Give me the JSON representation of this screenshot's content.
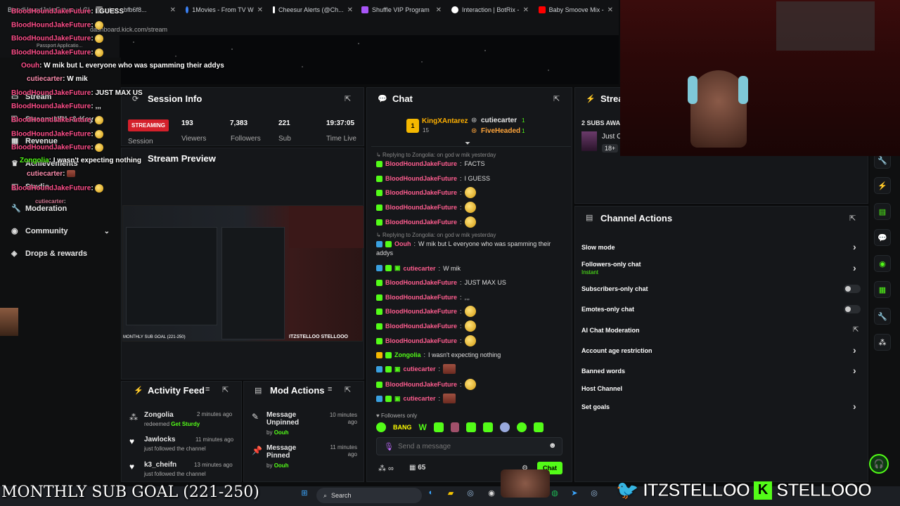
{
  "browser": {
    "tabs": [
      {
        "label": "BloodHoundJakeFuture : I GUESS",
        "icon_color": "#ff4f8b"
      },
      {
        "label": "shot - bfb6f8...",
        "icon_color": "#888888"
      },
      {
        "label": "1Movies - From TV W",
        "icon_color": "#3b82f6"
      },
      {
        "label": "Cheesur Alerts (@Ch...",
        "icon_color": "#ffffff"
      },
      {
        "label": "Shuffle VIP Program",
        "icon_color": "#a855f7"
      },
      {
        "label": "Interaction | BotRix -",
        "icon_color": "#ffffff"
      },
      {
        "label": "Baby Smoove Mix -",
        "icon_color": "#ff0000"
      }
    ],
    "url": "dashboard.kick.com/stream",
    "passport": "Passport Applicatio..."
  },
  "sidebar": {
    "items": [
      {
        "label": "Stream",
        "icon": "stream-icon"
      },
      {
        "label": "Stream URL & Key",
        "icon": "key-icon"
      },
      {
        "label": "Revenue",
        "icon": "revenue-icon"
      },
      {
        "label": "Achievements",
        "icon": "trophy-icon"
      },
      {
        "label": "Studio",
        "icon": "studio-icon"
      },
      {
        "label": "Moderation",
        "icon": "wrench-icon"
      },
      {
        "label": "Community",
        "icon": "community-icon"
      },
      {
        "label": "Drops & rewards",
        "icon": "drops-icon"
      }
    ]
  },
  "session_info": {
    "title": "Session Info",
    "status": "STREAMING",
    "status_label": "Session",
    "stats": [
      {
        "value": "193",
        "label": "Viewers"
      },
      {
        "value": "7,383",
        "label": "Followers"
      },
      {
        "value": "221",
        "label": "Sub"
      },
      {
        "value": "19:37:05",
        "label": "Time Live"
      }
    ]
  },
  "stream_preview": {
    "title": "Stream Preview",
    "goal_text": "MONTHLY SUB GOAL (221-250)",
    "handles": "ITZSTELLOO  STELLOOO"
  },
  "activity_feed": {
    "title": "Activity Feed",
    "items": [
      {
        "user": "Zongolia",
        "action": "redeemed",
        "reward": "Get Sturdy",
        "time": "2 minutes ago",
        "icon": "redeem-icon"
      },
      {
        "user": "Jawlocks",
        "action": "just followed the channel",
        "time": "11 minutes ago",
        "icon": "heart-icon"
      },
      {
        "user": "k3_cheifn",
        "action": "just followed the channel",
        "time": "13 minutes ago",
        "icon": "heart-icon"
      }
    ]
  },
  "mod_actions": {
    "title": "Mod Actions",
    "items": [
      {
        "action": "Message Unpinned",
        "by_label": "by",
        "by": "Oouh",
        "time": "10 minutes ago"
      },
      {
        "action": "Message Pinned",
        "by_label": "by",
        "by": "Oouh",
        "time": "11 minutes ago"
      }
    ]
  },
  "chat": {
    "title": "Chat",
    "top_gifters": [
      {
        "name": "KingXAntarez",
        "count": "15",
        "rank": "1"
      },
      {
        "name": "cutiecarter",
        "count": "1"
      },
      {
        "name": "FiveHeaded",
        "count": "1"
      }
    ],
    "messages": [
      {
        "reply": "Replying to Zongolia: on god w mik yesterday",
        "user": "BloodHoundJakeFuture",
        "text": "FACTS",
        "color": "pink"
      },
      {
        "user": "BloodHoundJakeFuture",
        "text": "I GUESS",
        "color": "pink"
      },
      {
        "user": "BloodHoundJakeFuture",
        "text": "",
        "emote": true,
        "color": "pink"
      },
      {
        "user": "BloodHoundJakeFuture",
        "text": "",
        "emote": true,
        "color": "pink"
      },
      {
        "user": "BloodHoundJakeFuture",
        "text": "",
        "emote": true,
        "color": "pink"
      },
      {
        "reply": "Replying to Zongolia: on god w mik yesterday",
        "user": "Oouh",
        "text": "W mik but L everyone who was spamming their",
        "text2": "addys",
        "color": "pink"
      },
      {
        "user": "cutiecarter",
        "text": "W mik",
        "color": "pink"
      },
      {
        "user": "BloodHoundJakeFuture",
        "text": "JUST MAX US",
        "color": "pink"
      },
      {
        "user": "BloodHoundJakeFuture",
        "text": ",,,",
        "color": "pink"
      },
      {
        "user": "BloodHoundJakeFuture",
        "text": "",
        "emote": true,
        "color": "pink"
      },
      {
        "user": "BloodHoundJakeFuture",
        "text": "",
        "emote": true,
        "color": "pink"
      },
      {
        "user": "BloodHoundJakeFuture",
        "text": "",
        "emote": true,
        "color": "pink"
      },
      {
        "user": "Zongolia",
        "text": "I wasn't expecting nothing",
        "color": "green"
      },
      {
        "user": "cutiecarter",
        "text": "",
        "img": true,
        "color": "pink"
      },
      {
        "user": "BloodHoundJakeFuture",
        "text": "",
        "emote": true,
        "color": "pink"
      },
      {
        "user": "cutiecarter",
        "text": "",
        "img": true,
        "color": "pink"
      }
    ],
    "mode": "Followers only",
    "input_placeholder": "Send a message",
    "viewer_count": "65",
    "send_label": "Chat"
  },
  "stream_panel": {
    "title": "Strea",
    "subs_text": "2 SUBS AWA",
    "sub_item": "Just C",
    "age_badge": "18+"
  },
  "channel_actions": {
    "title": "Channel Actions",
    "items": [
      {
        "label": "Slow mode",
        "control": "chevron"
      },
      {
        "label": "Followers-only chat",
        "sub": "Instant",
        "control": "chevron"
      },
      {
        "label": "Subscribers-only chat",
        "control": "toggle"
      },
      {
        "label": "Emotes-only chat",
        "control": "toggle"
      },
      {
        "label": "AI Chat Moderation",
        "control": "external"
      },
      {
        "label": "Account age restriction",
        "control": "chevron"
      },
      {
        "label": "Banned words",
        "control": "chevron"
      },
      {
        "label": "Host Channel",
        "control": "none"
      },
      {
        "label": "Set goals",
        "control": "chevron"
      }
    ]
  },
  "overlay_chat": [
    {
      "user": "BloodHoundJakeFuture",
      "text": ": I GUESS"
    },
    {
      "user": "BloodHoundJakeFuture",
      "text": ":"
    },
    {
      "user": "BloodHoundJakeFuture",
      "text": ":"
    },
    {
      "user": "BloodHoundJakeFuture",
      "text": ":"
    },
    {
      "user": "Oouh",
      "text": ": W mik but L everyone who was spamming their addys"
    },
    {
      "user": "cutiecarter",
      "text": ": W mik"
    },
    {
      "user": "BloodHoundJakeFuture",
      "text": ": JUST MAX US"
    },
    {
      "user": "BloodHoundJakeFuture",
      "text": ": ,,,"
    },
    {
      "user": "BloodHoundJakeFuture",
      "text": ":"
    },
    {
      "user": "BloodHoundJakeFuture",
      "text": ":"
    },
    {
      "user": "BloodHoundJakeFuture",
      "text": ":"
    },
    {
      "user": "Zongolia",
      "text": ": I wasn't expecting nothing"
    },
    {
      "user": "cutiecarter",
      "text": ":"
    },
    {
      "user": "BloodHoundJakeFuture",
      "text": ":"
    },
    {
      "user": "cutiecarter",
      "text": ":"
    }
  ],
  "bottom_overlay": {
    "goal": "MONTHLY SUB GOAL (221-250)",
    "handle1": "ITZSTELLOO",
    "handle2": "STELLOOO"
  },
  "taskbar": {
    "search_placeholder": "Search"
  },
  "colors": {
    "kick_green": "#53fc18",
    "pink_user": "#ff5d8f",
    "live_red": "#d4202b"
  }
}
